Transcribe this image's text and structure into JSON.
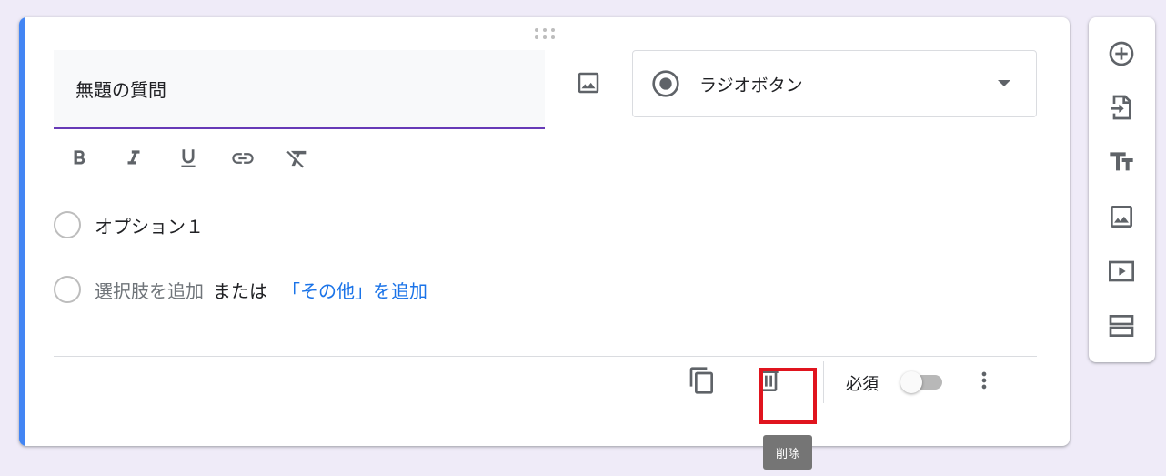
{
  "question": {
    "title": "無題の質問",
    "type_label": "ラジオボタン"
  },
  "formatting": {
    "icons": [
      "bold-icon",
      "italic-icon",
      "underline-icon",
      "link-icon",
      "clear-format-icon"
    ]
  },
  "options": {
    "option1_label": "オプション１",
    "add_option_label": "選択肢を追加",
    "or_label": "または",
    "add_other_label": "「その他」を追加"
  },
  "footer": {
    "required_label": "必須",
    "required_on": false,
    "delete_tooltip": "削除"
  },
  "colors": {
    "background": "#efebf8",
    "accent_bar": "#4285f4",
    "title_underline": "#673ab7",
    "link": "#1a73e8",
    "highlight_box": "#e0141e"
  },
  "sidebar": {
    "icons": [
      "add-question-icon",
      "import-questions-icon",
      "title-text-icon",
      "add-image-icon",
      "add-video-icon",
      "add-section-icon"
    ]
  }
}
